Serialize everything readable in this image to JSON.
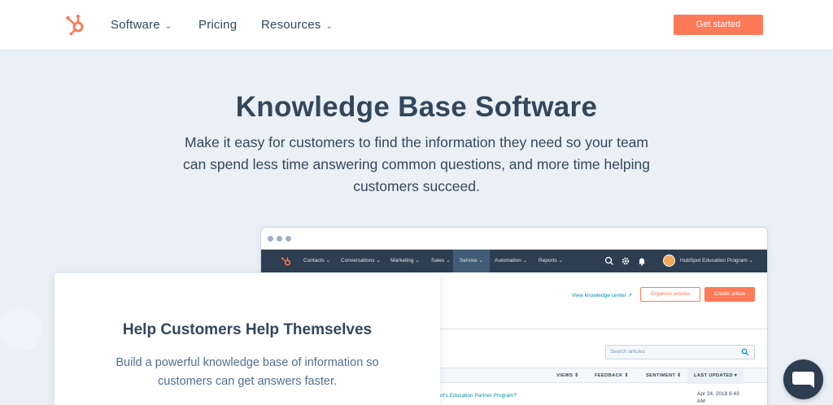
{
  "nav": {
    "items": [
      {
        "label": "Software",
        "has_dropdown": true
      },
      {
        "label": "Pricing",
        "has_dropdown": false
      },
      {
        "label": "Resources",
        "has_dropdown": true
      }
    ],
    "cta_label": "Get started",
    "logo_icon": "hubspot-sprocket-icon"
  },
  "hero": {
    "title": "Knowledge Base Software",
    "subtitle": "Make it easy for customers to find the information they need so your team can spend less time answering common questions, and more time helping customers succeed."
  },
  "app": {
    "nav_items": [
      "Contacts",
      "Conversations",
      "Marketing",
      "Sales",
      "Service",
      "Automation",
      "Reports"
    ],
    "active_nav_item": "Service",
    "account_name": "HubSpot Education Program",
    "view_kb_link": "View knowledge center",
    "organize_button": "Organize articles",
    "create_button": "Create article",
    "search_placeholder": "Search articles",
    "columns": [
      "VIEWS",
      "FEEDBACK",
      "SENTIMENT",
      "LAST UPDATED"
    ],
    "row_title_fragment": "ot's Education Partner Program?",
    "row_date": "Apr 24, 2018 8:43 AM"
  },
  "card": {
    "title": "Help Customers Help Themselves",
    "body": "Build a powerful knowledge base of information so customers can get answers faster."
  },
  "colors": {
    "accent": "#ff7a59",
    "dark_nav": "#2d3e50",
    "text": "#33475b",
    "link": "#0091ae",
    "background": "#eaf0f6"
  },
  "chat_icon": "chat-bubble-icon"
}
